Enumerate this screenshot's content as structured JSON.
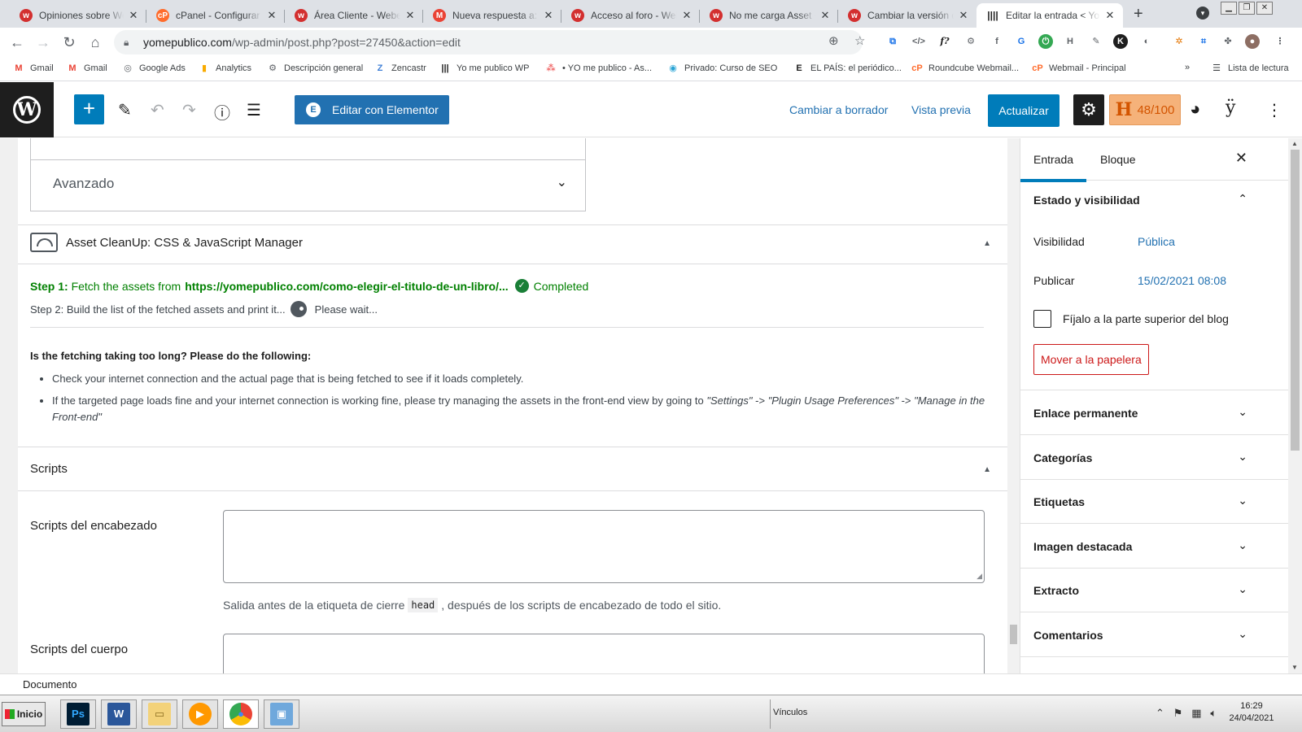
{
  "browser": {
    "tabs": [
      {
        "title": "Opiniones sobre Webempresa",
        "icon": "webempresa-icon",
        "color": "#d32f2f",
        "letter": "w"
      },
      {
        "title": "cPanel - Configurar PHP",
        "icon": "cpanel-icon",
        "color": "#ff6c2c",
        "letter": "cP"
      },
      {
        "title": "Área Cliente - Webempresa",
        "icon": "webempresa-icon",
        "color": "#d32f2f",
        "letter": "w"
      },
      {
        "title": "Nueva respuesta a: No me carga",
        "icon": "gmail-icon",
        "color": "#ea4335",
        "letter": "M"
      },
      {
        "title": "Acceso al foro - Webempresa",
        "icon": "webempresa-icon",
        "color": "#d32f2f",
        "letter": "w"
      },
      {
        "title": "No me carga Asset CleanUp",
        "icon": "webempresa-icon",
        "color": "#d32f2f",
        "letter": "w"
      },
      {
        "title": "Cambiar la versión de PHP",
        "icon": "webempresa-icon",
        "color": "#d32f2f",
        "letter": "w"
      },
      {
        "title": "Editar la entrada < Yo me publico",
        "icon": "yomepublico-icon",
        "color": "#1e1e1e",
        "letter": "||||",
        "active": true
      }
    ],
    "url_host": "yomepublico.com",
    "url_path": "/wp-admin/post.php?post=27450&action=edit",
    "bookmarks": [
      {
        "label": "Gmail",
        "icon": "gmail-icon",
        "color": "#ea4335",
        "glyph": "M"
      },
      {
        "label": "Gmail",
        "icon": "gmail-icon",
        "color": "#ea4335",
        "glyph": "M"
      },
      {
        "label": "Google Ads",
        "icon": "google-ads-icon",
        "color": "#5f6368",
        "glyph": "◎"
      },
      {
        "label": "Analytics",
        "icon": "analytics-icon",
        "color": "#f9ab00",
        "glyph": "▮"
      },
      {
        "label": "Descripción general",
        "icon": "search-console-icon",
        "color": "#5f6368",
        "glyph": "⚙"
      },
      {
        "label": "Zencastr",
        "icon": "zencastr-icon",
        "color": "#3f7fd6",
        "glyph": "Z"
      },
      {
        "label": "Yo me publico WP",
        "icon": "yomepublico-icon",
        "color": "#1e1e1e",
        "glyph": "|||"
      },
      {
        "label": "• YO me publico - As...",
        "icon": "asana-icon",
        "color": "#f06a6a",
        "glyph": "⁂"
      },
      {
        "label": "Privado: Curso de SEO",
        "icon": "site-icon",
        "color": "#2aa4d5",
        "glyph": "◉"
      },
      {
        "label": "EL PAÍS: el periódico...",
        "icon": "elpais-icon",
        "color": "#1e1e1e",
        "glyph": "E"
      },
      {
        "label": "Roundcube Webmail...",
        "icon": "cpanel-icon",
        "color": "#ff6c2c",
        "glyph": "cP"
      },
      {
        "label": "Webmail - Principal",
        "icon": "cpanel-icon",
        "color": "#ff6c2c",
        "glyph": "cP"
      }
    ],
    "bookmarks_more": "»",
    "reading_list": "Lista de lectura"
  },
  "wp": {
    "elementor_label": "Editar con Elementor",
    "switch_draft": "Cambiar a borrador",
    "preview": "Vista previa",
    "update": "Actualizar",
    "seo_score": "48/100"
  },
  "main": {
    "advanced_label": "Avanzado",
    "asset_title": "Asset CleanUp: CSS & JavaScript Manager",
    "step1_label": "Step 1:",
    "step1_text": "Fetch the assets from",
    "step1_url": "https://yomepublico.com/como-elegir-el-titulo-de-un-libro/...",
    "step1_status": "Completed",
    "step2_label": "Step 2:",
    "step2_text": "Build the list of the fetched assets and print it...",
    "step2_status": "Please wait...",
    "question": "Is the fetching taking too long? Please do the following:",
    "bullet1": "Check your internet connection and the actual page that is being fetched to see if it loads completely.",
    "bullet2_pre": "If the targeted page loads fine and your internet connection is working fine, please try managing the assets in the front-end view by going to ",
    "bullet2_settings": "\"Settings\"",
    "bullet2_arrow1": " -> ",
    "bullet2_prefs": "\"Plugin Usage Preferences\"",
    "bullet2_arrow2": " -> ",
    "bullet2_manage": "\"Manage in the Front-end\"",
    "scripts_title": "Scripts",
    "header_scripts_label": "Scripts del encabezado",
    "header_help_pre": "Salida antes de la etiqueta de cierre",
    "header_help_code": "head",
    "header_help_post": ", después de los scripts de encabezado de todo el sitio.",
    "body_scripts_label": "Scripts del cuerpo"
  },
  "sidebar": {
    "tab_post": "Entrada",
    "tab_block": "Bloque",
    "status_title": "Estado y visibilidad",
    "visibility_label": "Visibilidad",
    "visibility_value": "Pública",
    "publish_label": "Publicar",
    "publish_value": "15/02/2021 08:08",
    "sticky_label": "Fíjalo a la parte superior del blog",
    "trash_label": "Mover a la papelera",
    "panels": [
      "Enlace permanente",
      "Categorías",
      "Etiquetas",
      "Imagen destacada",
      "Extracto",
      "Comentarios"
    ]
  },
  "footer": {
    "label": "Documento"
  },
  "taskbar": {
    "start": "Inicio",
    "links": "Vínculos",
    "time": "16:29",
    "date": "24/04/2021"
  }
}
